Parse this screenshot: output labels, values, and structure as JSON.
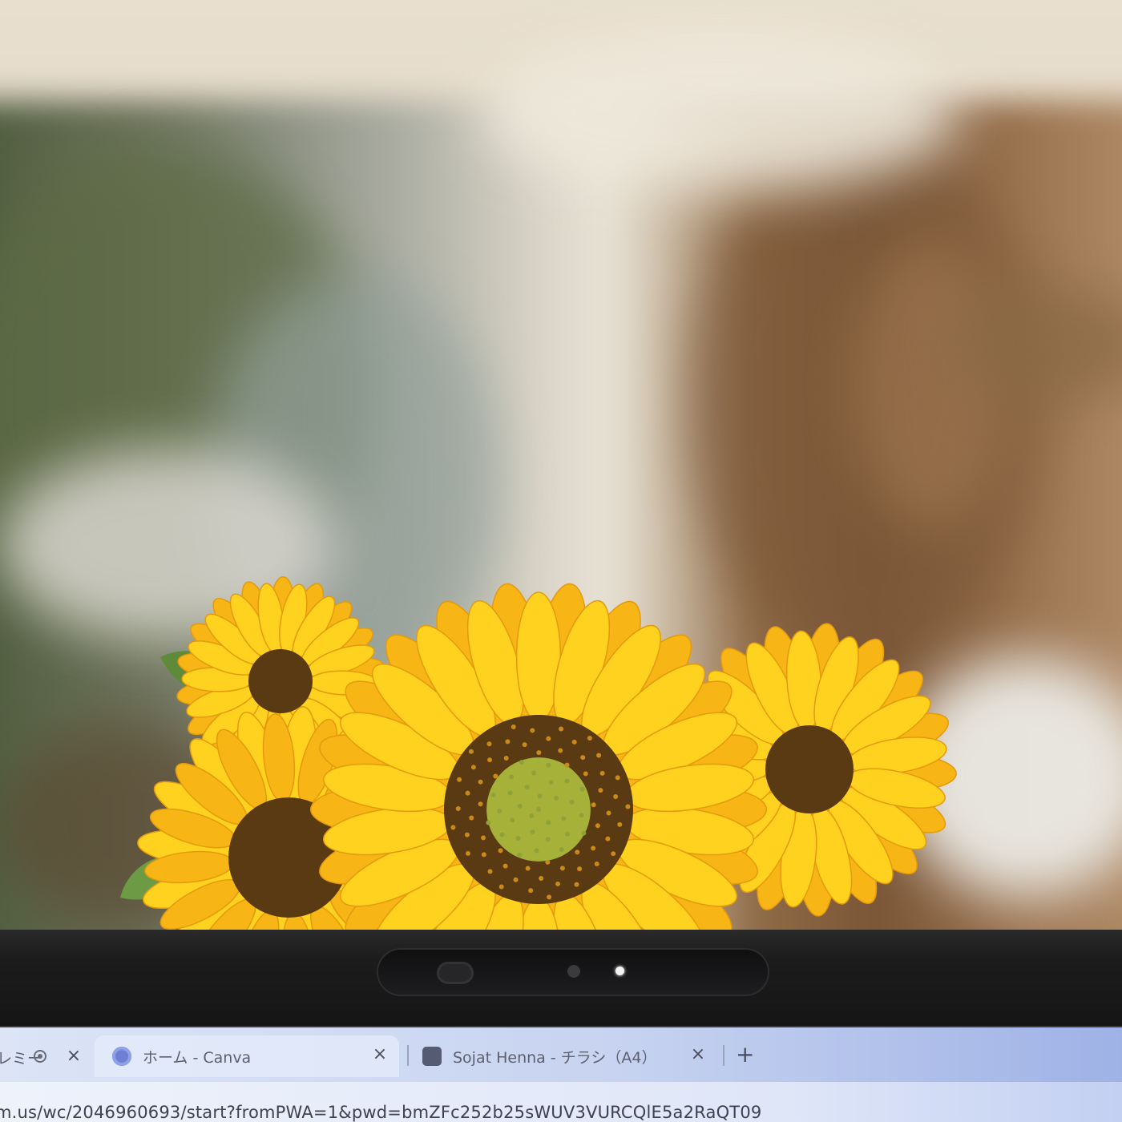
{
  "browser": {
    "partial_tab_label": "レミー",
    "tabs": [
      {
        "label": "ホーム - Canva",
        "icon": "canva-icon"
      },
      {
        "label": "Sojat Henna - チラシ（A4）",
        "icon": "document-icon"
      }
    ],
    "close_symbol": "×",
    "new_tab_symbol": "+",
    "url": "m.us/wc/2046960693/start?fromPWA=1&pwd=bmZFc252b25sWUV3VURCQlE5a2RaQT09"
  },
  "scene": {
    "subject": "sunflower bouquet",
    "colors": {
      "petal": "#f7b516",
      "petal_light": "#ffd21f",
      "seed_center": "#5a3a12",
      "disk_green": "#a6b13a",
      "bezel": "#1b1b1c",
      "tabbar": "#c7d3f0"
    }
  }
}
